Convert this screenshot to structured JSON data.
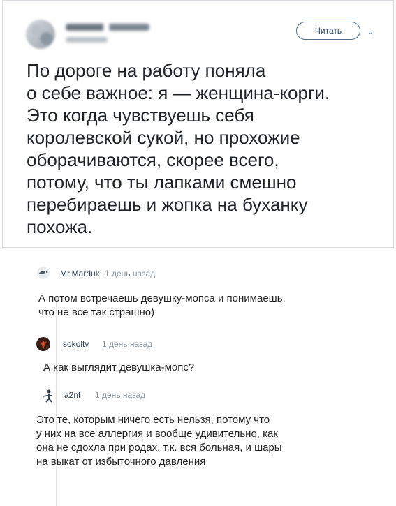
{
  "tweet": {
    "follow_label": "Читать",
    "chevron": "⌄",
    "text": "По дороге на работу поняла\nо себе важное: я — женщина-корги.\nЭто когда чувствуешь себя\nкоролевской сукой, но прохожие\nоборачиваются, скорее всего,\nпотому, что ты лапками смешно\nперебираешь и жопка на буханку\nпохожа."
  },
  "comments": [
    {
      "author": "Mr.Marduk",
      "time": "1 день назад",
      "text": "А потом встречаешь девушку-мопса и понимаешь,\nчто не все так страшно)",
      "avatar": "bird-avatar"
    },
    {
      "author": "sokoltv",
      "time": "1 день назад",
      "text": "А как выглядит девушка-мопс?",
      "avatar": "red-mask-avatar"
    },
    {
      "author": "a2nt",
      "time": "1 день назад",
      "text": "Это те, которым ничего есть нельзя, потому что\nу них на все аллергия и вообще удивительно, как\nона не сдохла при родах, т.к. вся больная, и шары\nна выкат от избыточного давления",
      "avatar": "figure-avatar"
    }
  ]
}
